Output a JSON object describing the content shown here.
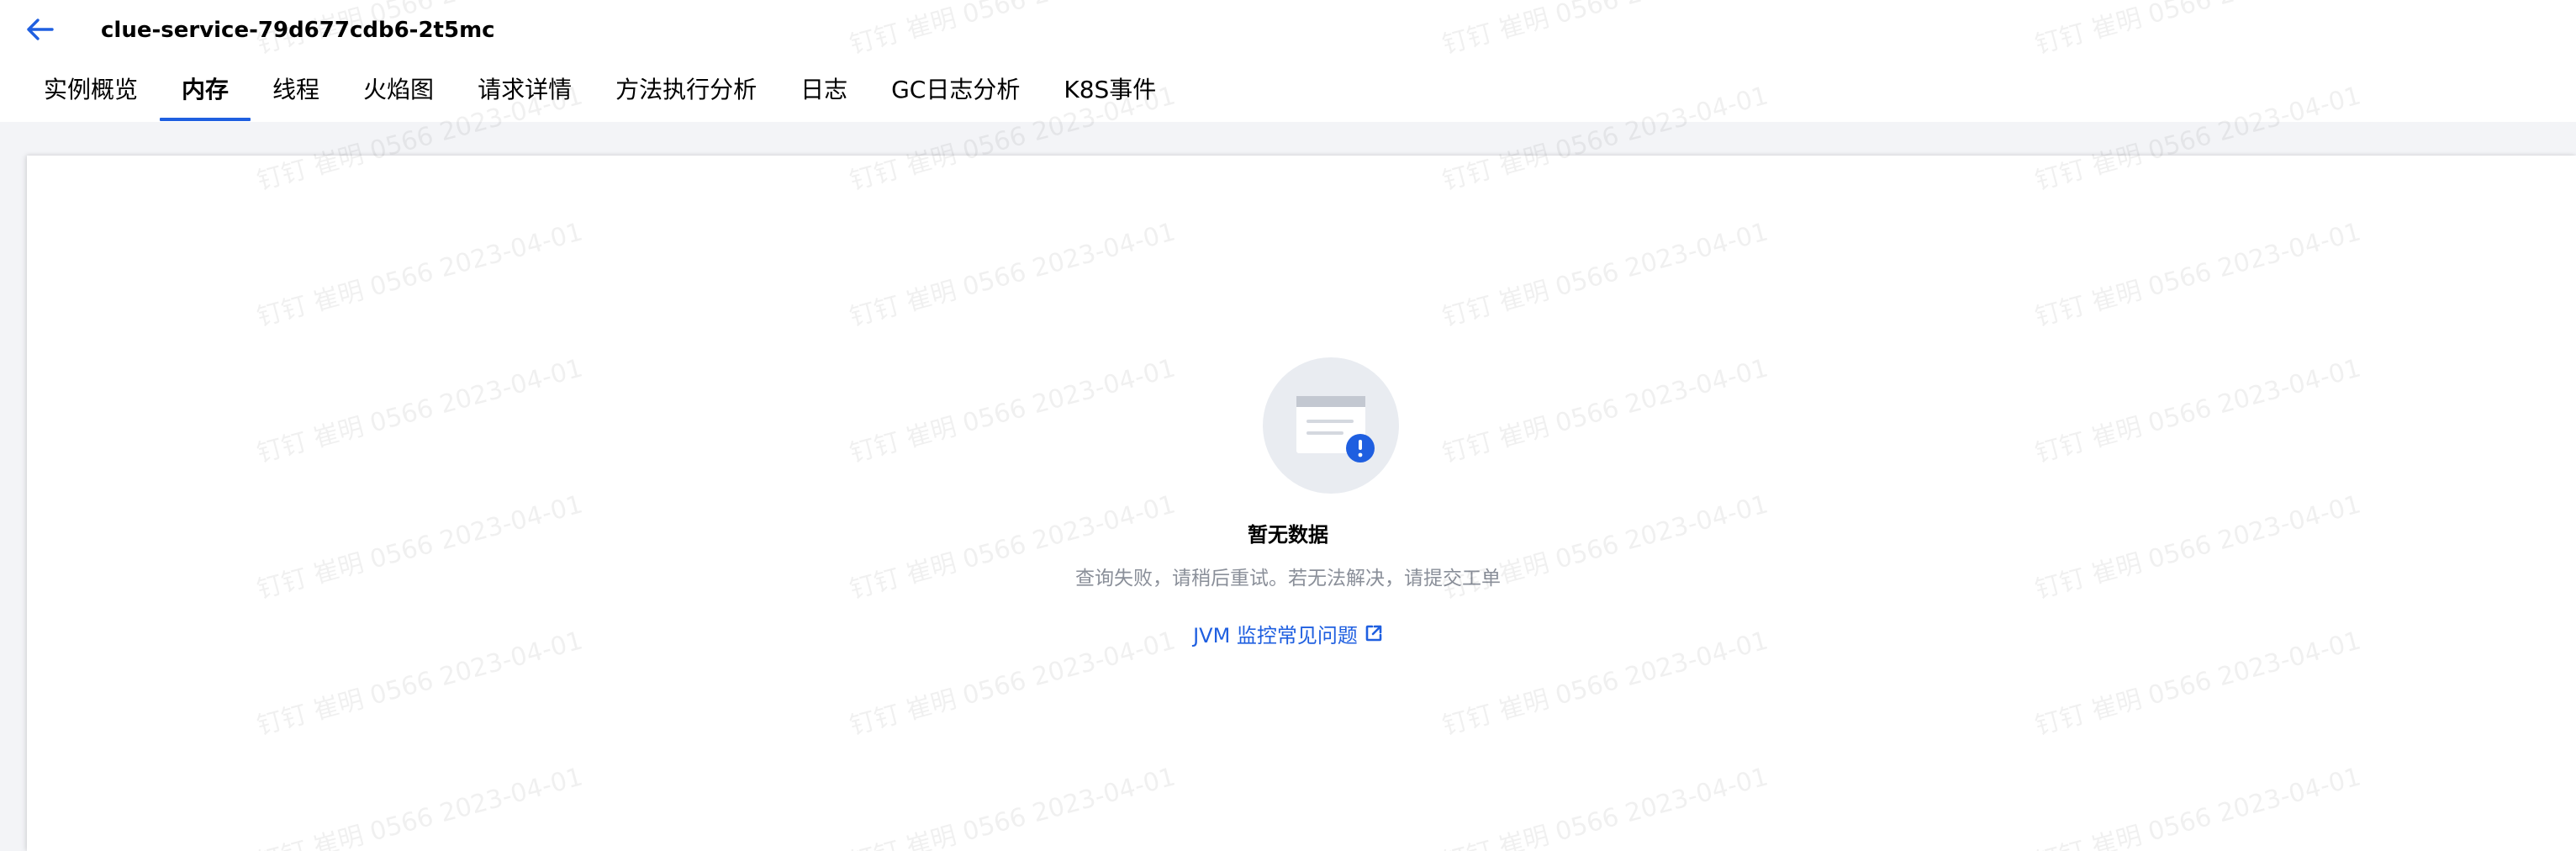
{
  "header": {
    "title": "clue-service-79d677cdb6-2t5mc",
    "back_icon": "arrow-left-icon",
    "accent_color": "#1f5fe0"
  },
  "tabs": [
    {
      "label": "实例概览",
      "active": false
    },
    {
      "label": "内存",
      "active": true
    },
    {
      "label": "线程",
      "active": false
    },
    {
      "label": "火焰图",
      "active": false
    },
    {
      "label": "请求详情",
      "active": false
    },
    {
      "label": "方法执行分析",
      "active": false
    },
    {
      "label": "日志",
      "active": false
    },
    {
      "label": "GC日志分析",
      "active": false
    },
    {
      "label": "K8S事件",
      "active": false
    }
  ],
  "empty_state": {
    "icon": "empty-document-alert-icon",
    "title": "暂无数据",
    "description": "查询失败，请稍后重试。若无法解决，请提交工单",
    "link_label": "JVM 监控常见问题",
    "link_icon": "external-link-icon"
  },
  "watermark": {
    "text": "钉钉 崔明 0566 2023-04-01"
  }
}
